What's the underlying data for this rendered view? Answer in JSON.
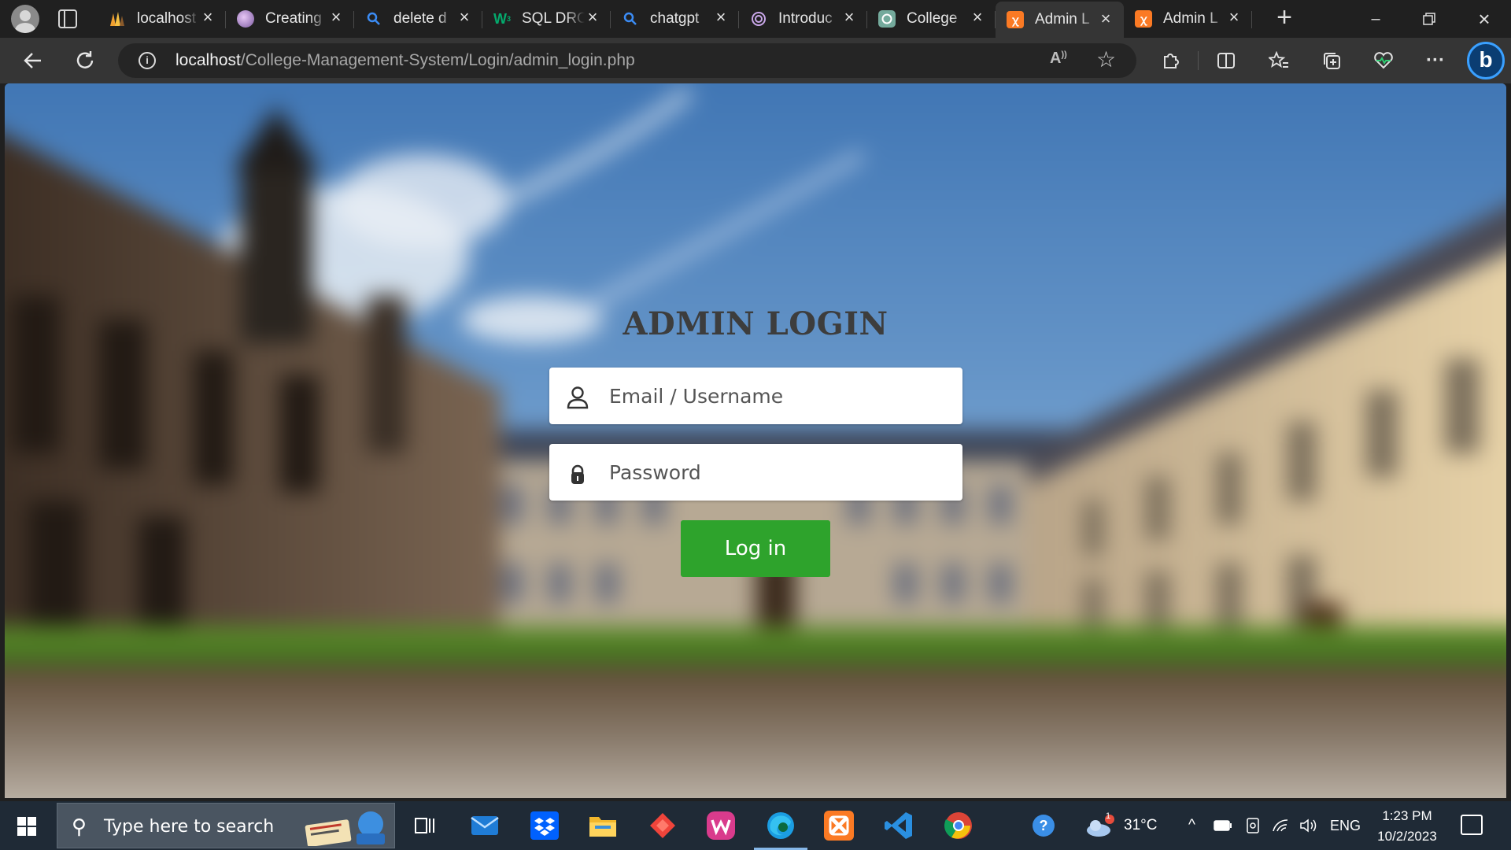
{
  "browser": {
    "tabs": [
      {
        "label": "localhost",
        "icon": "phpmyadmin-icon",
        "color": "#f0a030"
      },
      {
        "label": "Creating",
        "icon": "avatar-icon",
        "color": "#b58ac8"
      },
      {
        "label": "delete d",
        "icon": "search-icon",
        "color": "#3b8cf5"
      },
      {
        "label": "SQL DRO",
        "icon": "w3schools-icon",
        "color": "#04aa6d"
      },
      {
        "label": "chatgpt",
        "icon": "search-icon",
        "color": "#3b8cf5"
      },
      {
        "label": "Introduc",
        "icon": "openai-icon",
        "color": "#c9a7e9"
      },
      {
        "label": "College",
        "icon": "chatgpt-icon",
        "color": "#74aa9c"
      },
      {
        "label": "Admin L",
        "icon": "xampp-icon",
        "color": "#fb7a24",
        "active": true
      },
      {
        "label": "Admin L",
        "icon": "xampp-icon",
        "color": "#fb7a24"
      }
    ],
    "address": {
      "host": "localhost",
      "path": "/College-Management-System/Login/admin_login.php"
    }
  },
  "login": {
    "title": "ADMIN LOGIN",
    "email_placeholder": "Email / Username",
    "password_placeholder": "Password",
    "submit_label": "Log in",
    "button_color": "#2ea32c"
  },
  "taskbar": {
    "search_placeholder": "Type here to search",
    "weather": "31°C",
    "weather_badge": "1",
    "language": "ENG",
    "time": "1:23 PM",
    "date": "10/2/2023"
  }
}
